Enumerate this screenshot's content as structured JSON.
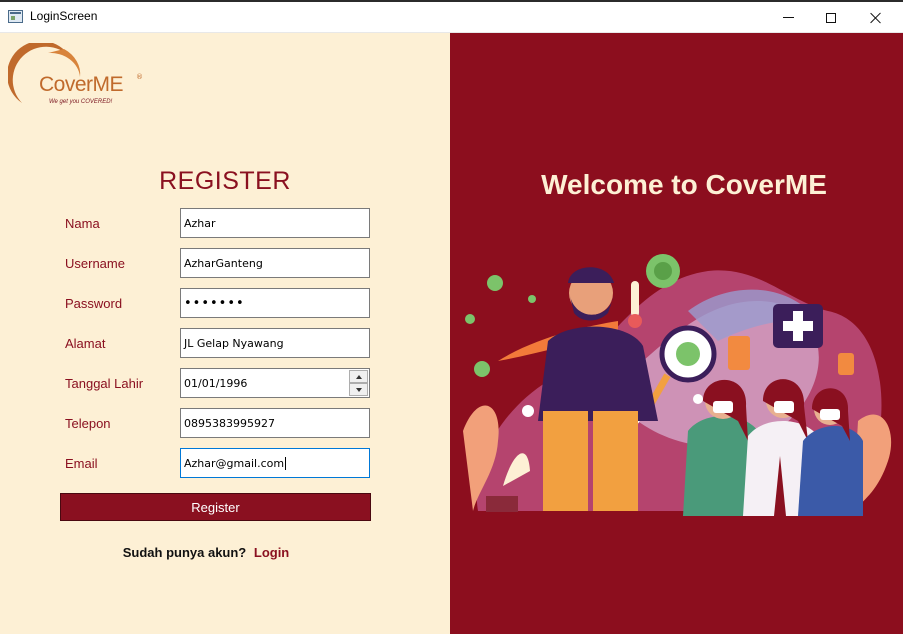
{
  "window": {
    "title": "LoginScreen"
  },
  "brand": {
    "name": "CoverME",
    "registered": "®",
    "tagline": "We get you COVERED!"
  },
  "form": {
    "title": "REGISTER",
    "fields": [
      {
        "label": "Nama",
        "value": "Azhar"
      },
      {
        "label": "Username",
        "value": "AzharGanteng"
      },
      {
        "label": "Password",
        "value": "•••••••"
      },
      {
        "label": "Alamat",
        "value": "JL Gelap Nyawang"
      },
      {
        "label": "Tanggal Lahir",
        "value": "01/01/1996"
      },
      {
        "label": "Telepon",
        "value": "0895383995927"
      },
      {
        "label": "Email",
        "value": "Azhar@gmail.com"
      }
    ],
    "submit_label": "Register",
    "login_prompt": "Sudah punya akun?",
    "login_link": "Login"
  },
  "welcome": {
    "title": "Welcome to CoverME"
  },
  "colors": {
    "accent": "#8c0e1e",
    "panel_bg": "#fdf0d5",
    "logo_orange": "#c06a2c"
  }
}
